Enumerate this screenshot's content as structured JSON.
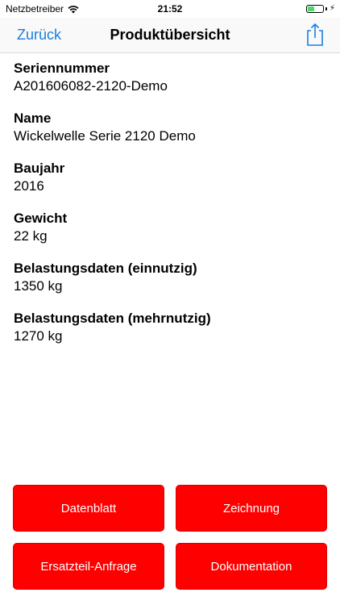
{
  "status_bar": {
    "carrier": "Netzbetreiber",
    "time": "21:52",
    "battery_level": 0.45,
    "charging_symbol": "⚡"
  },
  "nav": {
    "back_label": "Zurück",
    "title": "Produktübersicht",
    "share_icon": "share-icon"
  },
  "fields": [
    {
      "label": "Seriennummer",
      "value": "A201606082-2120-Demo"
    },
    {
      "label": "Name",
      "value": "Wickelwelle Serie 2120 Demo"
    },
    {
      "label": "Baujahr",
      "value": "2016"
    },
    {
      "label": "Gewicht",
      "value": "22 kg"
    },
    {
      "label": "Belastungsdaten (einnutzig)",
      "value": "1350 kg"
    },
    {
      "label": "Belastungsdaten (mehrnutzig)",
      "value": "1270 kg"
    }
  ],
  "buttons": {
    "datenblatt": "Datenblatt",
    "zeichnung": "Zeichnung",
    "ersatzteil": "Ersatzteil-Anfrage",
    "dokumentation": "Dokumentation"
  },
  "colors": {
    "accent": "#1a7fe0",
    "button_red": "#ff0000",
    "battery_green": "#4cd964"
  }
}
